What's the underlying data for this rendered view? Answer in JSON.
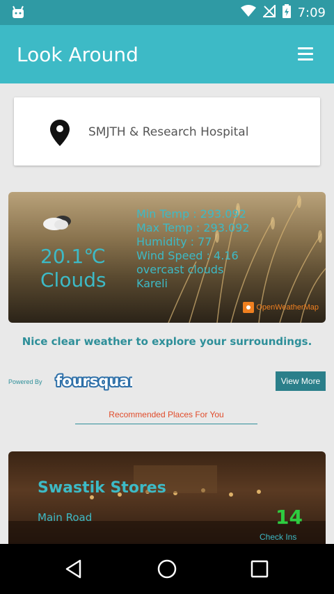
{
  "status_bar": {
    "time": "7:09"
  },
  "app_bar": {
    "title": "Look Around"
  },
  "location": {
    "name": "SMJTH & Research Hospital"
  },
  "weather": {
    "temperature": "20.1℃",
    "condition": "Clouds",
    "details": [
      "Min Temp : 293.092",
      "Max Temp : 293.092",
      "Humidity : 77",
      "Wind Speed : 4.16",
      "overcast clouds",
      "Kareli"
    ],
    "provider": "OpenWeatherMap",
    "tagline": "Nice clear weather to explore your surroundings."
  },
  "foursquare": {
    "powered_by": "Powered By",
    "logo_text": "foursquare",
    "view_more_label": "View More"
  },
  "recommended": {
    "label": "Recommended Places For You"
  },
  "place": {
    "name": "Swastik Stores",
    "address": "Main Road",
    "checkins_count": "14",
    "checkins_label": "Check Ins"
  },
  "colors": {
    "app_bar": "#3dbac6",
    "status_bar": "#2f9aa4",
    "accent_text": "#3dbac6",
    "checkins": "#2ecc40",
    "recommended_label": "#e04b2a",
    "view_more_bg": "#2b7f8a"
  },
  "icons": {
    "status_left": "android-debug-icon",
    "wifi": "wifi-icon",
    "signal": "no-signal-icon",
    "battery": "battery-charging-icon",
    "menu": "hamburger-menu-icon",
    "location": "map-pin-icon",
    "weather": "cloud-moon-icon",
    "back": "nav-back-icon",
    "home": "nav-home-icon",
    "recents": "nav-recents-icon"
  }
}
